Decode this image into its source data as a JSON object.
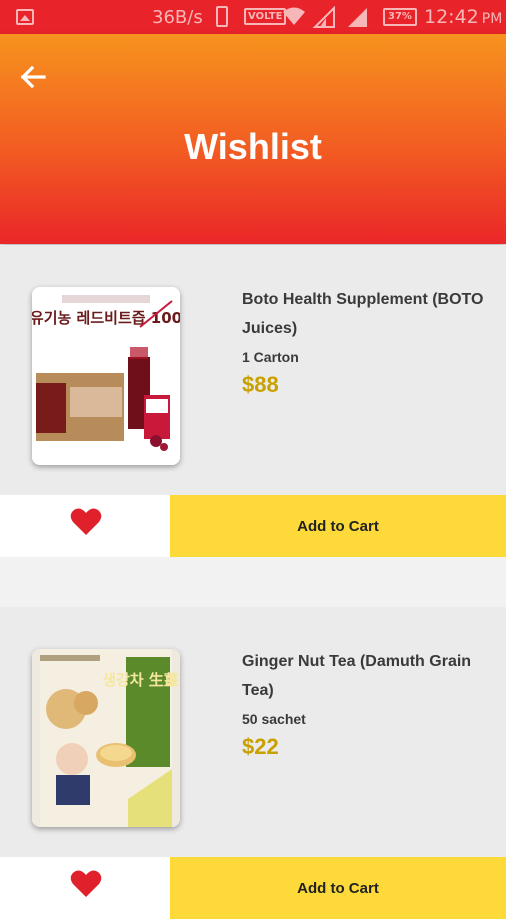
{
  "status_bar": {
    "speed": "36B/s",
    "volte": "VOLTE",
    "battery": "37%",
    "time": "12:42",
    "ampm": "PM"
  },
  "header": {
    "title": "Wishlist",
    "back_icon": "arrow-left-icon"
  },
  "colors": {
    "header_top": "#f7931e",
    "header_bottom": "#ea2629",
    "price": "#c8a000",
    "add_to_cart_bg": "#fdd93a",
    "heart": "#e0202a"
  },
  "items": [
    {
      "name": "Boto Health Supplement (BOTO Juices)",
      "quantity": "1 Carton",
      "price": "$88",
      "add_to_cart_label": "Add to Cart",
      "image_text": "유기농 레드비트즙 100"
    },
    {
      "name": "Ginger Nut Tea (Damuth Grain Tea)",
      "quantity": "50 sachet",
      "price": "$22",
      "add_to_cart_label": "Add to Cart",
      "image_text": "생강차 生薑茶"
    }
  ]
}
